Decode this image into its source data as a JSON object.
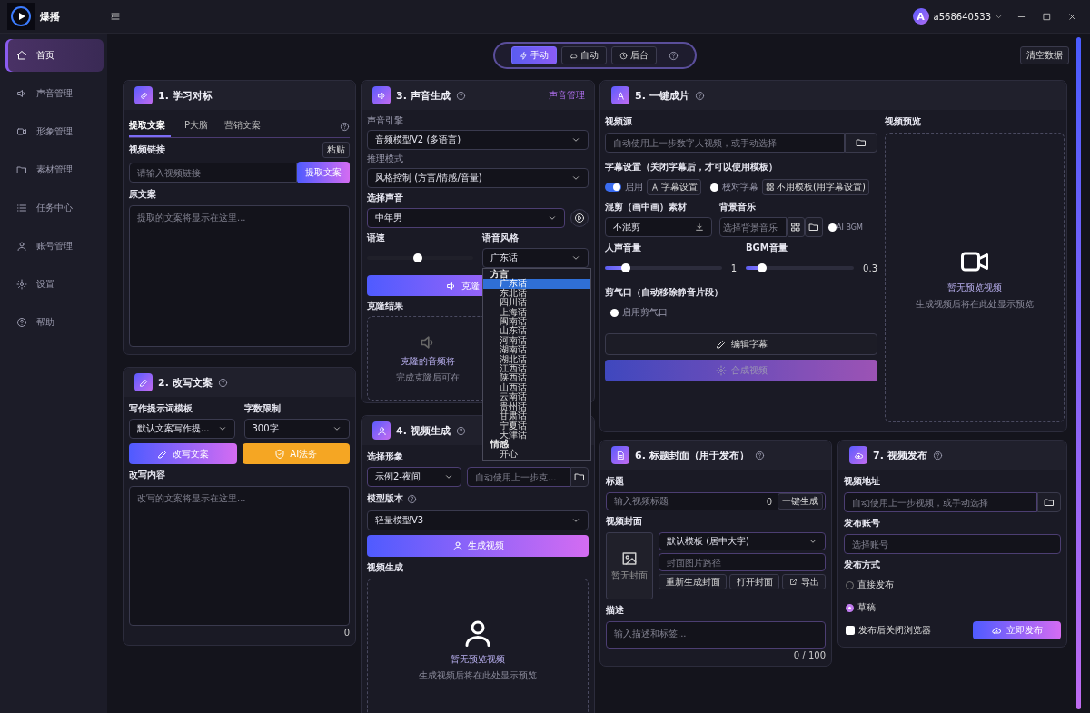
{
  "titlebar": {
    "app_name": "爆播",
    "user_avatar": "A",
    "user_name": "a568640533"
  },
  "sidebar": {
    "items": [
      {
        "label": "首页",
        "selected": true
      },
      {
        "label": "声音管理",
        "selected": false
      },
      {
        "label": "形象管理",
        "selected": false
      },
      {
        "label": "素材管理",
        "selected": false
      },
      {
        "label": "任务中心",
        "selected": false
      },
      {
        "label": "账号管理",
        "selected": false
      },
      {
        "label": "设置",
        "selected": false
      },
      {
        "label": "帮助",
        "selected": false
      }
    ]
  },
  "modes": [
    {
      "label": "手动",
      "selected": true
    },
    {
      "label": "自动",
      "selected": false
    },
    {
      "label": "后台",
      "selected": false
    }
  ],
  "clear_button": "清空数据",
  "learn": {
    "title": "1. 学习对标",
    "tabs": [
      {
        "label": "提取文案",
        "selected": true
      },
      {
        "label": "IP大脑",
        "selected": false
      },
      {
        "label": "营销文案",
        "selected": false
      }
    ],
    "link_label": "视频链接",
    "paste_button": "粘贴",
    "link_placeholder": "请输入视频链接",
    "extract_button": "提取文案",
    "source_label": "原文案",
    "source_placeholder": "提取的文案将显示在这里..."
  },
  "rewrite": {
    "title": "2. 改写文案",
    "template_label": "写作提示词模板",
    "template_value": "默认文案写作提...",
    "limit_label": "字数限制",
    "limit_value": "300字",
    "rewrite_button": "改写文案",
    "legal_button": "AI法务",
    "content_label": "改写内容",
    "content_placeholder": "改写的文案将显示在这里...",
    "count": "0"
  },
  "voice": {
    "title": "3. 声音生成",
    "manage_link": "声音管理",
    "engine_label": "声音引擎",
    "engine_value": "音频模型V2 (多语言)",
    "mode_label": "推理模式",
    "mode_value": "风格控制 (方言/情感/音量)",
    "voice_label": "选择声音",
    "voice_value": "中年男",
    "speed_label": "语速",
    "speed": {
      "level": 0.48
    },
    "style_label": "语音风格",
    "style_value": "广东话",
    "style_groups": [
      {
        "group": "方言",
        "options": [
          {
            "label": "广东话",
            "selected": true
          },
          {
            "label": "东北话",
            "selected": false
          },
          {
            "label": "四川话",
            "selected": false
          },
          {
            "label": "上海话",
            "selected": false
          },
          {
            "label": "闽南话",
            "selected": false
          },
          {
            "label": "山东话",
            "selected": false
          },
          {
            "label": "河南话",
            "selected": false
          },
          {
            "label": "湖南话",
            "selected": false
          },
          {
            "label": "湖北话",
            "selected": false
          },
          {
            "label": "江西话",
            "selected": false
          },
          {
            "label": "陕西话",
            "selected": false
          },
          {
            "label": "山西话",
            "selected": false
          },
          {
            "label": "云南话",
            "selected": false
          },
          {
            "label": "贵州话",
            "selected": false
          },
          {
            "label": "甘肃话",
            "selected": false
          },
          {
            "label": "宁夏话",
            "selected": false
          },
          {
            "label": "天津话",
            "selected": false
          }
        ]
      },
      {
        "group": "情感",
        "options": [
          {
            "label": "开心",
            "selected": false
          }
        ]
      }
    ],
    "clone_button": "克隆",
    "result_label": "克隆结果",
    "result_title": "克隆的音频将",
    "result_hint": "完成克隆后可在"
  },
  "video": {
    "title": "4. 视频生成",
    "avatar_label": "选择形象",
    "avatar_value": "示例2-夜间",
    "audio_placeholder": "自动使用上一步克...",
    "model_label": "模型版本",
    "model_value": "轻量模型V3",
    "generate_button": "生成视频",
    "preview_label": "视频生成",
    "preview_title": "暂无预览视频",
    "preview_hint": "生成视频后将在此处显示预览"
  },
  "oneclick": {
    "title": "5. 一键成片",
    "source_label": "视频源",
    "source_placeholder": "自动使用上一步数字人视频，或手动选择",
    "subtitle_label": "字幕设置（关闭字幕后，才可以使用模板）",
    "subtitle_on": true,
    "subtitle_on_label": "启用",
    "subtitle_settings_button": "字幕设置",
    "proofread": false,
    "proofread_label": "校对字幕",
    "template_button": "不用模板(用字幕设置)",
    "mix_label": "混剪（画中画）素材",
    "mix_value": "不混剪",
    "bgm_label": "背景音乐",
    "bgm_placeholder": "选择背景音乐",
    "ai_bgm": false,
    "ai_bgm_label": "AI BGM",
    "voice_volume_label": "人声音量",
    "voice_volume": {
      "level": 0.18,
      "reading": "1"
    },
    "bgm_volume_label": "BGM音量",
    "bgm_volume": {
      "level": 0.15,
      "reading": "0.3"
    },
    "cut_label": "剪气口（自动移除静音片段）",
    "cut_on": false,
    "cut_on_label": "启用剪气口",
    "edit_button": "编辑字幕",
    "compose_button": "合成视频",
    "compose_disabled": true,
    "preview_label": "视频预览",
    "preview_title": "暂无预览视频",
    "preview_hint": "生成视频后将在此处显示预览"
  },
  "cover": {
    "title": "6. 标题封面（用于发布）",
    "title_label": "标题",
    "title_placeholder": "输入视频标题",
    "title_count": "0",
    "generate_button": "一键生成",
    "cover_label": "视频封面",
    "cover_empty": "暂无封面",
    "template_value": "默认模板 (居中大字)",
    "path_placeholder": "封面图片路径",
    "regen_button": "重新生成封面",
    "open_button": "打开封面",
    "export_button": "导出",
    "desc_label": "描述",
    "desc_placeholder": "输入描述和标签...",
    "desc_count": "0 / 100"
  },
  "publish": {
    "title": "7. 视频发布",
    "address_label": "视频地址",
    "address_placeholder": "自动使用上一步视频，或手动选择",
    "account_label": "发布账号",
    "account_placeholder": "选择账号",
    "method_label": "发布方式",
    "methods": [
      {
        "label": "直接发布",
        "selected": false
      },
      {
        "label": "草稿",
        "selected": true
      }
    ],
    "close_browser": {
      "label": "发布后关闭浏览器",
      "checked": false
    },
    "publish_button": "立即发布"
  }
}
